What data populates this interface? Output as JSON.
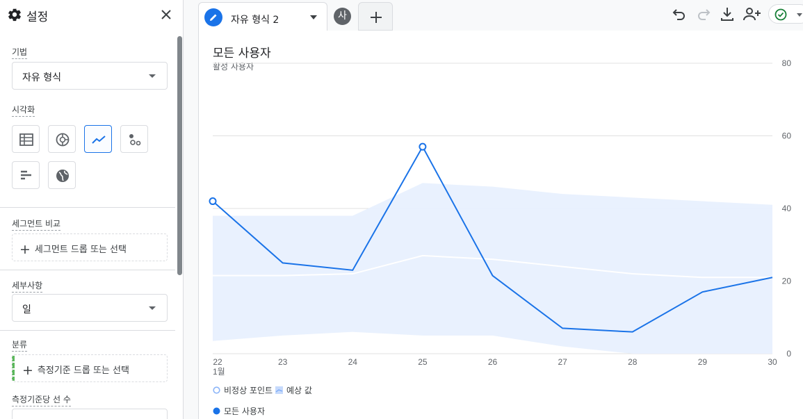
{
  "sidebar": {
    "title": "설정",
    "technique": {
      "label": "기법",
      "value": "자유 형식"
    },
    "visualization": {
      "label": "시각화",
      "icons": [
        "table-icon",
        "donut-chart-icon",
        "line-chart-icon",
        "scatter-icon",
        "bar-chart-icon",
        "geo-map-icon"
      ],
      "selected": "line-chart-icon"
    },
    "segment_compare": {
      "label": "세그먼트 비교",
      "placeholder": "세그먼트 드롭 또는 선택"
    },
    "granularity": {
      "label": "세부사항",
      "value": "일"
    },
    "breakdown": {
      "label": "분류",
      "placeholder": "측정기준 드롭 또는 선택"
    },
    "rows_per_dimension": {
      "label": "측정기준당 선 수"
    }
  },
  "tab": {
    "label": "자유 형식 2"
  },
  "avatar": {
    "initial": "사"
  },
  "toolbar": {
    "icons": [
      "undo-icon",
      "redo-icon",
      "download-icon",
      "share-user-icon",
      "check-status-icon"
    ]
  },
  "accent_color": "#1a73e8",
  "chart_data": {
    "type": "line",
    "title": "모든 사용자",
    "ylabel": "활성 사용자",
    "x": [
      "22",
      "23",
      "24",
      "25",
      "26",
      "27",
      "28",
      "29",
      "30"
    ],
    "x_sub_label": "1월",
    "y_ticks": [
      "0",
      "20",
      "40",
      "60",
      "80"
    ],
    "ylim": [
      0,
      80
    ],
    "series": [
      {
        "name": "모든 사용자",
        "values": [
          42,
          25,
          23,
          57,
          21.5,
          7,
          6,
          17,
          21
        ],
        "color": "#1a73e8"
      }
    ],
    "forecast": {
      "upper": [
        38,
        38,
        38,
        47,
        46,
        44,
        43,
        42,
        41
      ],
      "mean": [
        21.5,
        21.5,
        22,
        27,
        26,
        24,
        22,
        21,
        21
      ],
      "lower": [
        3.5,
        5,
        6,
        5,
        5,
        2,
        0,
        0,
        0
      ],
      "color": "#e8f0fe"
    },
    "anomalies": [
      0,
      3
    ],
    "grid": true,
    "legend": {
      "anomaly_label": "비정상 포인트",
      "forecast_label": "예상 값",
      "series_label": "모든 사용자"
    }
  }
}
